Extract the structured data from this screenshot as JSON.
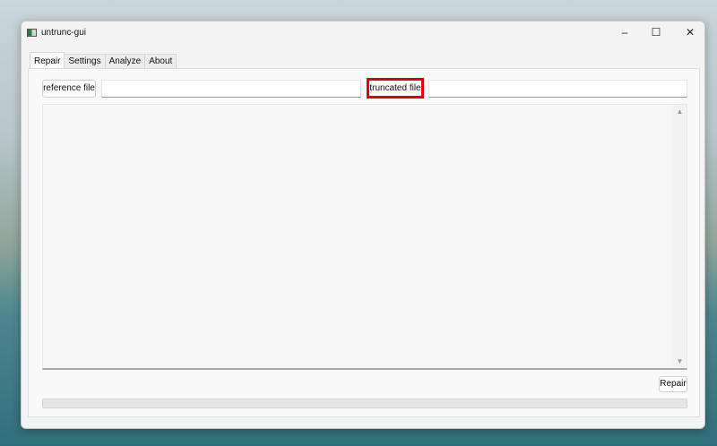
{
  "window": {
    "title": "untrunc-gui"
  },
  "tabs": [
    "Repair",
    "Settings",
    "Analyze",
    "About"
  ],
  "repair": {
    "reference_button": "reference file",
    "reference_value": "",
    "truncated_button": "truncated file",
    "truncated_value": "",
    "log_text": "",
    "repair_button": "Repair",
    "progress": 0
  },
  "colors": {
    "highlight": "#e00000"
  }
}
